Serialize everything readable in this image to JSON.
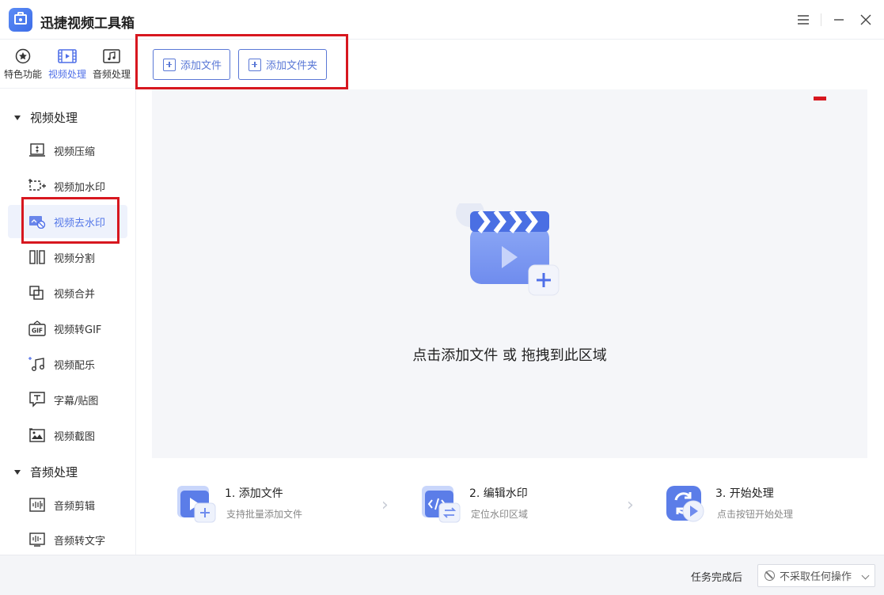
{
  "app": {
    "title": "迅捷视频工具箱"
  },
  "window_controls": {
    "menu_icon": "menu-icon",
    "minimize_icon": "minimize-icon",
    "close_icon": "close-icon"
  },
  "sidebar": {
    "top_tabs": [
      {
        "label": "特色功能",
        "icon": "star-icon",
        "active": false
      },
      {
        "label": "视频处理",
        "icon": "film-icon",
        "active": true
      },
      {
        "label": "音频处理",
        "icon": "music-icon",
        "active": false
      }
    ],
    "groups": [
      {
        "title": "视频处理",
        "items": [
          {
            "label": "视频压缩",
            "icon": "compress-icon"
          },
          {
            "label": "视频加水印",
            "icon": "add-watermark-icon"
          },
          {
            "label": "视频去水印",
            "icon": "remove-watermark-icon",
            "active": true
          },
          {
            "label": "视频分割",
            "icon": "split-icon"
          },
          {
            "label": "视频合并",
            "icon": "merge-icon"
          },
          {
            "label": "视频转GIF",
            "icon": "gif-icon"
          },
          {
            "label": "视频配乐",
            "icon": "music-note-icon"
          },
          {
            "label": "字幕/贴图",
            "icon": "subtitle-icon"
          },
          {
            "label": "视频截图",
            "icon": "screenshot-icon"
          }
        ]
      },
      {
        "title": "音频处理",
        "items": [
          {
            "label": "音频剪辑",
            "icon": "audio-cut-icon"
          },
          {
            "label": "音频转文字",
            "icon": "audio-to-text-icon"
          }
        ]
      }
    ]
  },
  "toolbar": {
    "add_file": "添加文件",
    "add_folder": "添加文件夹"
  },
  "drop_area": {
    "hint": "点击添加文件 或 拖拽到此区域"
  },
  "steps": [
    {
      "title": "1. 添加文件",
      "desc": "支持批量添加文件"
    },
    {
      "title": "2. 编辑水印",
      "desc": "定位水印区域"
    },
    {
      "title": "3. 开始处理",
      "desc": "点击按钮开始处理"
    }
  ],
  "status_bar": {
    "label": "任务完成后",
    "selected_option": "不采取任何操作"
  },
  "colors": {
    "accent": "#4f6fe8",
    "highlight": "#d7171f",
    "drop_bg": "#f5f6f9"
  }
}
